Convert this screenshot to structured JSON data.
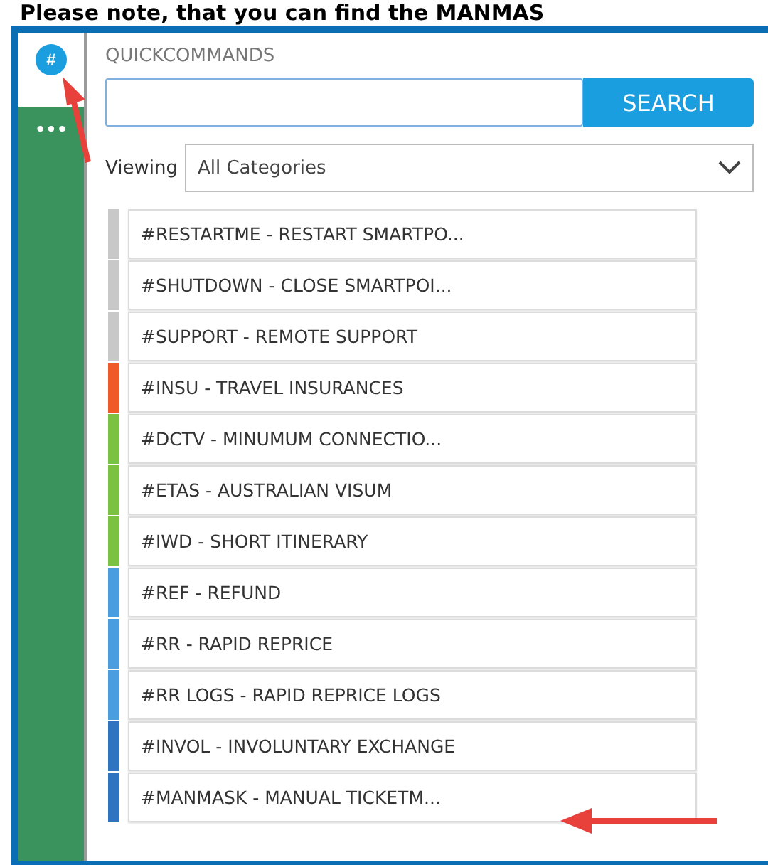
{
  "caption": "Please note, that you can find the MANMAS",
  "sidebar": {
    "items": [
      {
        "label": "#",
        "kind": "badge",
        "selected": true
      },
      {
        "label": "•••",
        "kind": "plain",
        "selected": false
      }
    ]
  },
  "panel": {
    "title": "QUICKCOMMANDS",
    "search": {
      "button": "SEARCH"
    },
    "filter": {
      "label": "Viewing",
      "value": "All Categories"
    }
  },
  "commands": [
    {
      "label": "#RESTARTME - RESTART SMARTPO...",
      "color": "#c8c8c8"
    },
    {
      "label": "#SHUTDOWN - CLOSE SMARTPOI...",
      "color": "#c8c8c8"
    },
    {
      "label": "#SUPPORT - REMOTE SUPPORT",
      "color": "#c8c8c8"
    },
    {
      "label": "#INSU - TRAVEL INSURANCES",
      "color": "#f05a28"
    },
    {
      "label": "#DCTV - MINUMUM CONNECTIO...",
      "color": "#7cc242"
    },
    {
      "label": "#ETAS - AUSTRALIAN VISUM",
      "color": "#7cc242"
    },
    {
      "label": "#IWD - SHORT ITINERARY",
      "color": "#7cc242"
    },
    {
      "label": "#REF - REFUND",
      "color": "#4a9ee0"
    },
    {
      "label": "#RR - RAPID REPRICE",
      "color": "#4a9ee0"
    },
    {
      "label": "#RR LOGS - RAPID REPRICE LOGS",
      "color": "#4a9ee0"
    },
    {
      "label": "#INVOL - INVOLUNTARY EXCHANGE",
      "color": "#2f74c0"
    },
    {
      "label": "#MANMASK - MANUAL TICKETM...",
      "color": "#2f74c0"
    }
  ]
}
